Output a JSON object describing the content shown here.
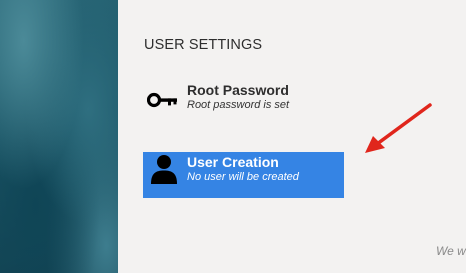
{
  "section": {
    "title": "USER SETTINGS"
  },
  "spokes": [
    {
      "title": "Root Password",
      "status": "Root password is set",
      "icon": "key-icon",
      "selected": false
    },
    {
      "title": "User Creation",
      "status": "No user will be created",
      "icon": "user-icon",
      "selected": true
    }
  ],
  "footer": {
    "text": "We w"
  },
  "colors": {
    "selected_bg": "#3584e4",
    "arrow": "#e0261c",
    "page_bg": "#f3f2f1"
  }
}
